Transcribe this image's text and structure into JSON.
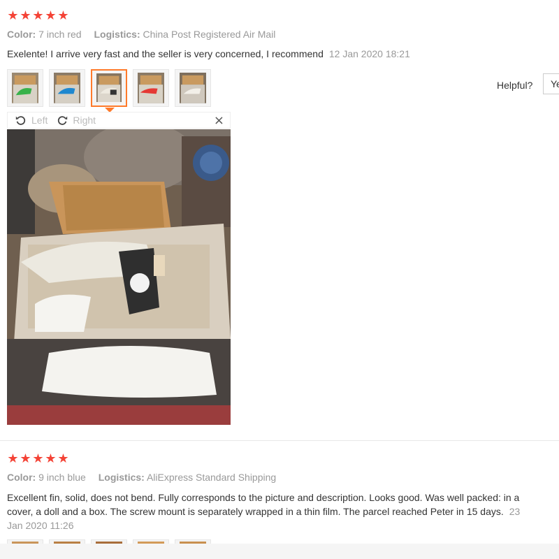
{
  "review1": {
    "stars": [
      "★",
      "★",
      "★",
      "★",
      "★"
    ],
    "color_label": "Color:",
    "color_value": "7 inch red",
    "logistics_label": "Logistics:",
    "logistics_value": "China Post Registered Air Mail",
    "comment": "Exelente! I arrive very fast and the seller is very concerned, I recommend",
    "date": "12 Jan 2020 18:21",
    "viewer": {
      "left_label": "Left",
      "right_label": "Right",
      "close": "×"
    }
  },
  "helpful": {
    "label": "Helpful?",
    "yes_label": "Ye"
  },
  "review2": {
    "stars": [
      "★",
      "★",
      "★",
      "★",
      "★"
    ],
    "color_label": "Color:",
    "color_value": "9 inch blue",
    "logistics_label": "Logistics:",
    "logistics_value": "AliExpress Standard Shipping",
    "comment_line1": "Excellent fin, solid, does not bend. Fully corresponds to the picture and description. Looks good. Was well packed: in a",
    "comment_line2": "cover, a doll and a box. The screw mount is separately wrapped in a thin film. The parcel reached Peter in 15 days.",
    "date_part1": "23",
    "date_part2": "Jan 2020 11:26"
  },
  "colors": {
    "star": "#f44336",
    "active_thumb": "#ff7a2a"
  }
}
